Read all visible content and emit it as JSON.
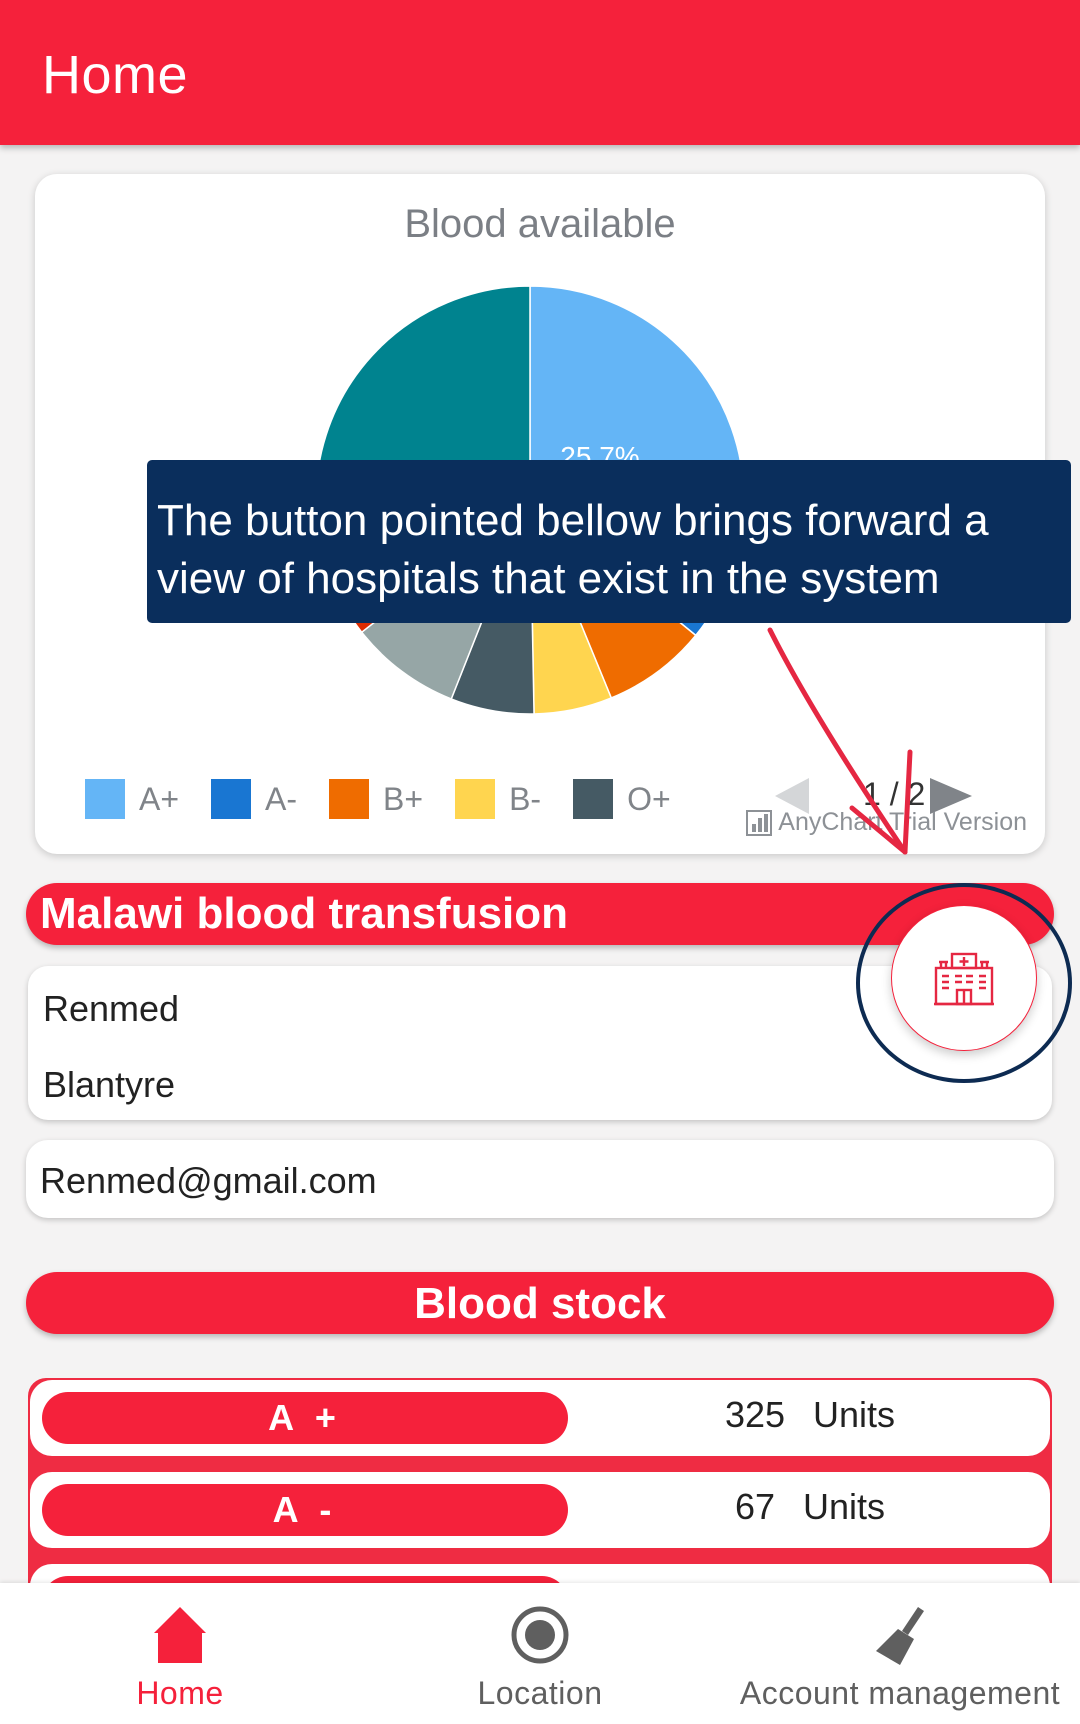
{
  "app_bar": {
    "title": "Home"
  },
  "chart_data": {
    "type": "pie",
    "title": "Blood available",
    "visible_slice_label": "25.7%",
    "slices": [
      {
        "label": "A+",
        "value": 25.7,
        "color": "#64b5f6"
      },
      {
        "label": "A-",
        "value": 10.2,
        "color": "#1976d2"
      },
      {
        "label": "B+",
        "value": 7.9,
        "color": "#ef6c00"
      },
      {
        "label": "B-",
        "value": 5.9,
        "color": "#ffd54f"
      },
      {
        "label": "O+",
        "value": 6.3,
        "color": "#455a64"
      },
      {
        "label": "",
        "value": 8.4,
        "color": "#96a6a6"
      },
      {
        "label": "",
        "value": 9.2,
        "color": "#dd2c00"
      },
      {
        "label": "",
        "value": 26.4,
        "color": "#00838f"
      }
    ],
    "legend": [
      "A+",
      "A-",
      "B+",
      "B-",
      "O+"
    ],
    "legend_placement": "bottom",
    "pager_text": "1 / 2",
    "watermark": "AnyChart Trial Version"
  },
  "tutorial_overlay": {
    "text": "The button pointed bellow brings forward a view of hospitals that exist in the system",
    "arrow_color": "#e52742",
    "highlight_color": "#0d2b52"
  },
  "hospital": {
    "header": "Malawi blood transfusion",
    "name": "Renmed",
    "city": "Blantyre",
    "email": "Renmed@gmail.com"
  },
  "fab": {
    "icon": "hospital-icon"
  },
  "blood_stock": {
    "header": "Blood stock",
    "rows": [
      {
        "type": "A +",
        "amount": "325",
        "unit": "Units"
      },
      {
        "type": "A -",
        "amount": "67",
        "unit": "Units"
      },
      {
        "type": "",
        "amount": "",
        "unit": ""
      }
    ]
  },
  "bottom_nav": {
    "items": [
      {
        "label": "Home",
        "icon": "home-icon",
        "active": true
      },
      {
        "label": "Location",
        "icon": "radio-target-icon",
        "active": false
      },
      {
        "label": "Account management",
        "icon": "broom-icon",
        "active": false
      }
    ]
  },
  "colors": {
    "brand": "#f5213b",
    "overlay": "#0a2e5c",
    "background": "#f4f3f3"
  }
}
